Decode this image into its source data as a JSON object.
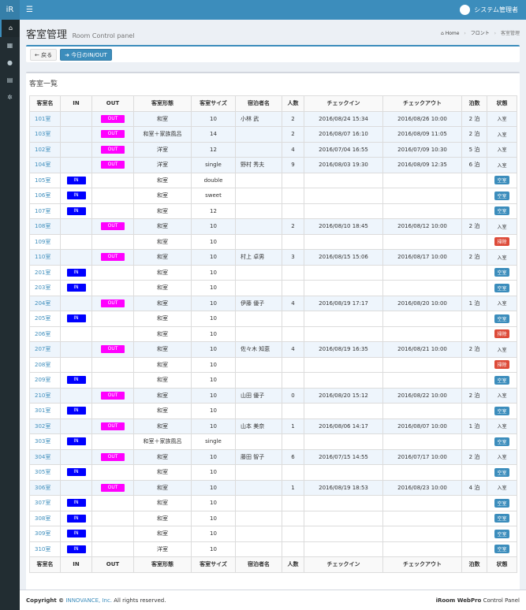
{
  "app": {
    "logo": "iR",
    "user": "システム管理者"
  },
  "sidebar": {
    "icons": [
      "home-icon",
      "calendar-icon",
      "user-icon",
      "print-icon",
      "gears-icon"
    ]
  },
  "header": {
    "title": "客室管理",
    "subtitle": "Room Control panel"
  },
  "breadcrumb": {
    "home": "Home",
    "mid": "フロント",
    "current": "客室管理"
  },
  "toolbar": {
    "back": "戻る",
    "today": "今日のIN/OUT"
  },
  "list": {
    "title": "客室一覧",
    "columns": [
      "客室名",
      "IN",
      "OUT",
      "客室形態",
      "客室サイズ",
      "宿泊者名",
      "人数",
      "チェックイン",
      "チェックアウト",
      "泊数",
      "状態"
    ],
    "rows": [
      {
        "room": "101室",
        "in": false,
        "out": true,
        "type": "和室",
        "size": "10",
        "guest": "小林 武",
        "count": "2",
        "checkin": "2016/08/24 15:34",
        "checkout": "2016/08/26 10:00",
        "nights": "2 泊",
        "status": "入室",
        "statusKind": "in"
      },
      {
        "room": "103室",
        "in": false,
        "out": true,
        "type": "和室＋家族風呂",
        "size": "14",
        "guest": "",
        "count": "2",
        "checkin": "2016/08/07 16:10",
        "checkout": "2016/08/09 11:05",
        "nights": "2 泊",
        "status": "入室",
        "statusKind": "in"
      },
      {
        "room": "102室",
        "in": false,
        "out": true,
        "type": "洋室",
        "size": "12",
        "guest": "",
        "count": "4",
        "checkin": "2016/07/04 16:55",
        "checkout": "2016/07/09 10:30",
        "nights": "5 泊",
        "status": "入室",
        "statusKind": "in"
      },
      {
        "room": "104室",
        "in": false,
        "out": true,
        "type": "洋室",
        "size": "single",
        "guest": "野村 秀夫",
        "count": "9",
        "checkin": "2016/08/03 19:30",
        "checkout": "2016/08/09 12:35",
        "nights": "6 泊",
        "status": "入室",
        "statusKind": "in"
      },
      {
        "room": "105室",
        "in": true,
        "out": false,
        "type": "和室",
        "size": "double",
        "guest": "",
        "count": "",
        "checkin": "",
        "checkout": "",
        "nights": "",
        "status": "空室",
        "statusKind": "vacant"
      },
      {
        "room": "106室",
        "in": true,
        "out": false,
        "type": "和室",
        "size": "sweet",
        "guest": "",
        "count": "",
        "checkin": "",
        "checkout": "",
        "nights": "",
        "status": "空室",
        "statusKind": "vacant"
      },
      {
        "room": "107室",
        "in": true,
        "out": false,
        "type": "和室",
        "size": "12",
        "guest": "",
        "count": "",
        "checkin": "",
        "checkout": "",
        "nights": "",
        "status": "空室",
        "statusKind": "vacant"
      },
      {
        "room": "108室",
        "in": false,
        "out": true,
        "type": "和室",
        "size": "10",
        "guest": "",
        "count": "2",
        "checkin": "2016/08/10 18:45",
        "checkout": "2016/08/12 10:00",
        "nights": "2 泊",
        "status": "入室",
        "statusKind": "in"
      },
      {
        "room": "109室",
        "in": false,
        "out": false,
        "type": "和室",
        "size": "10",
        "guest": "",
        "count": "",
        "checkin": "",
        "checkout": "",
        "nights": "",
        "status": "掃除",
        "statusKind": "cleaning"
      },
      {
        "room": "110室",
        "in": false,
        "out": true,
        "type": "和室",
        "size": "10",
        "guest": "村上 卓男",
        "count": "3",
        "checkin": "2016/08/15 15:06",
        "checkout": "2016/08/17 10:00",
        "nights": "2 泊",
        "status": "入室",
        "statusKind": "in"
      },
      {
        "room": "201室",
        "in": true,
        "out": false,
        "type": "和室",
        "size": "10",
        "guest": "",
        "count": "",
        "checkin": "",
        "checkout": "",
        "nights": "",
        "status": "空室",
        "statusKind": "vacant"
      },
      {
        "room": "203室",
        "in": true,
        "out": false,
        "type": "和室",
        "size": "10",
        "guest": "",
        "count": "",
        "checkin": "",
        "checkout": "",
        "nights": "",
        "status": "空室",
        "statusKind": "vacant"
      },
      {
        "room": "204室",
        "in": false,
        "out": true,
        "type": "和室",
        "size": "10",
        "guest": "伊藤 優子",
        "count": "4",
        "checkin": "2016/08/19 17:17",
        "checkout": "2016/08/20 10:00",
        "nights": "1 泊",
        "status": "入室",
        "statusKind": "in"
      },
      {
        "room": "205室",
        "in": true,
        "out": false,
        "type": "和室",
        "size": "10",
        "guest": "",
        "count": "",
        "checkin": "",
        "checkout": "",
        "nights": "",
        "status": "空室",
        "statusKind": "vacant"
      },
      {
        "room": "206室",
        "in": false,
        "out": false,
        "type": "和室",
        "size": "10",
        "guest": "",
        "count": "",
        "checkin": "",
        "checkout": "",
        "nights": "",
        "status": "掃除",
        "statusKind": "cleaning"
      },
      {
        "room": "207室",
        "in": false,
        "out": true,
        "type": "和室",
        "size": "10",
        "guest": "佐々木 知恵",
        "count": "4",
        "checkin": "2016/08/19 16:35",
        "checkout": "2016/08/21 10:00",
        "nights": "2 泊",
        "status": "入室",
        "statusKind": "in"
      },
      {
        "room": "208室",
        "in": false,
        "out": false,
        "type": "和室",
        "size": "10",
        "guest": "",
        "count": "",
        "checkin": "",
        "checkout": "",
        "nights": "",
        "status": "掃除",
        "statusKind": "cleaning"
      },
      {
        "room": "209室",
        "in": true,
        "out": false,
        "type": "和室",
        "size": "10",
        "guest": "",
        "count": "",
        "checkin": "",
        "checkout": "",
        "nights": "",
        "status": "空室",
        "statusKind": "vacant"
      },
      {
        "room": "210室",
        "in": false,
        "out": true,
        "type": "和室",
        "size": "10",
        "guest": "山田 優子",
        "count": "0",
        "checkin": "2016/08/20 15:12",
        "checkout": "2016/08/22 10:00",
        "nights": "2 泊",
        "status": "入室",
        "statusKind": "in"
      },
      {
        "room": "301室",
        "in": true,
        "out": false,
        "type": "和室",
        "size": "10",
        "guest": "",
        "count": "",
        "checkin": "",
        "checkout": "",
        "nights": "",
        "status": "空室",
        "statusKind": "vacant"
      },
      {
        "room": "302室",
        "in": false,
        "out": true,
        "type": "和室",
        "size": "10",
        "guest": "山本 美奈",
        "count": "1",
        "checkin": "2016/08/06 14:17",
        "checkout": "2016/08/07 10:00",
        "nights": "1 泊",
        "status": "入室",
        "statusKind": "in"
      },
      {
        "room": "303室",
        "in": true,
        "out": false,
        "type": "和室＋家族風呂",
        "size": "single",
        "guest": "",
        "count": "",
        "checkin": "",
        "checkout": "",
        "nights": "",
        "status": "空室",
        "statusKind": "vacant"
      },
      {
        "room": "304室",
        "in": false,
        "out": true,
        "type": "和室",
        "size": "10",
        "guest": "藤田 智子",
        "count": "6",
        "checkin": "2016/07/15 14:55",
        "checkout": "2016/07/17 10:00",
        "nights": "2 泊",
        "status": "入室",
        "statusKind": "in"
      },
      {
        "room": "305室",
        "in": true,
        "out": false,
        "type": "和室",
        "size": "10",
        "guest": "",
        "count": "",
        "checkin": "",
        "checkout": "",
        "nights": "",
        "status": "空室",
        "statusKind": "vacant"
      },
      {
        "room": "306室",
        "in": false,
        "out": true,
        "type": "和室",
        "size": "10",
        "guest": "",
        "count": "1",
        "checkin": "2016/08/19 18:53",
        "checkout": "2016/08/23 10:00",
        "nights": "4 泊",
        "status": "入室",
        "statusKind": "in"
      },
      {
        "room": "307室",
        "in": true,
        "out": false,
        "type": "和室",
        "size": "10",
        "guest": "",
        "count": "",
        "checkin": "",
        "checkout": "",
        "nights": "",
        "status": "空室",
        "statusKind": "vacant"
      },
      {
        "room": "308室",
        "in": true,
        "out": false,
        "type": "和室",
        "size": "10",
        "guest": "",
        "count": "",
        "checkin": "",
        "checkout": "",
        "nights": "",
        "status": "空室",
        "statusKind": "vacant"
      },
      {
        "room": "309室",
        "in": true,
        "out": false,
        "type": "和室",
        "size": "10",
        "guest": "",
        "count": "",
        "checkin": "",
        "checkout": "",
        "nights": "",
        "status": "空室",
        "statusKind": "vacant"
      },
      {
        "room": "310室",
        "in": true,
        "out": false,
        "type": "洋室",
        "size": "10",
        "guest": "",
        "count": "",
        "checkin": "",
        "checkout": "",
        "nights": "",
        "status": "空室",
        "statusKind": "vacant"
      }
    ],
    "in_label": "IN",
    "out_label": "OUT"
  },
  "footer": {
    "copy": "Copyright ©",
    "brand": "INNOVANCE, Inc.",
    "rights": "All rights reserved.",
    "product": "iRoom WebPro",
    "panel": "Control Panel"
  },
  "colors": {
    "primary": "#3c8dbc",
    "in_badge": "#0000ff",
    "out_badge": "#ff00ff",
    "cleaning": "#dd4b39"
  }
}
